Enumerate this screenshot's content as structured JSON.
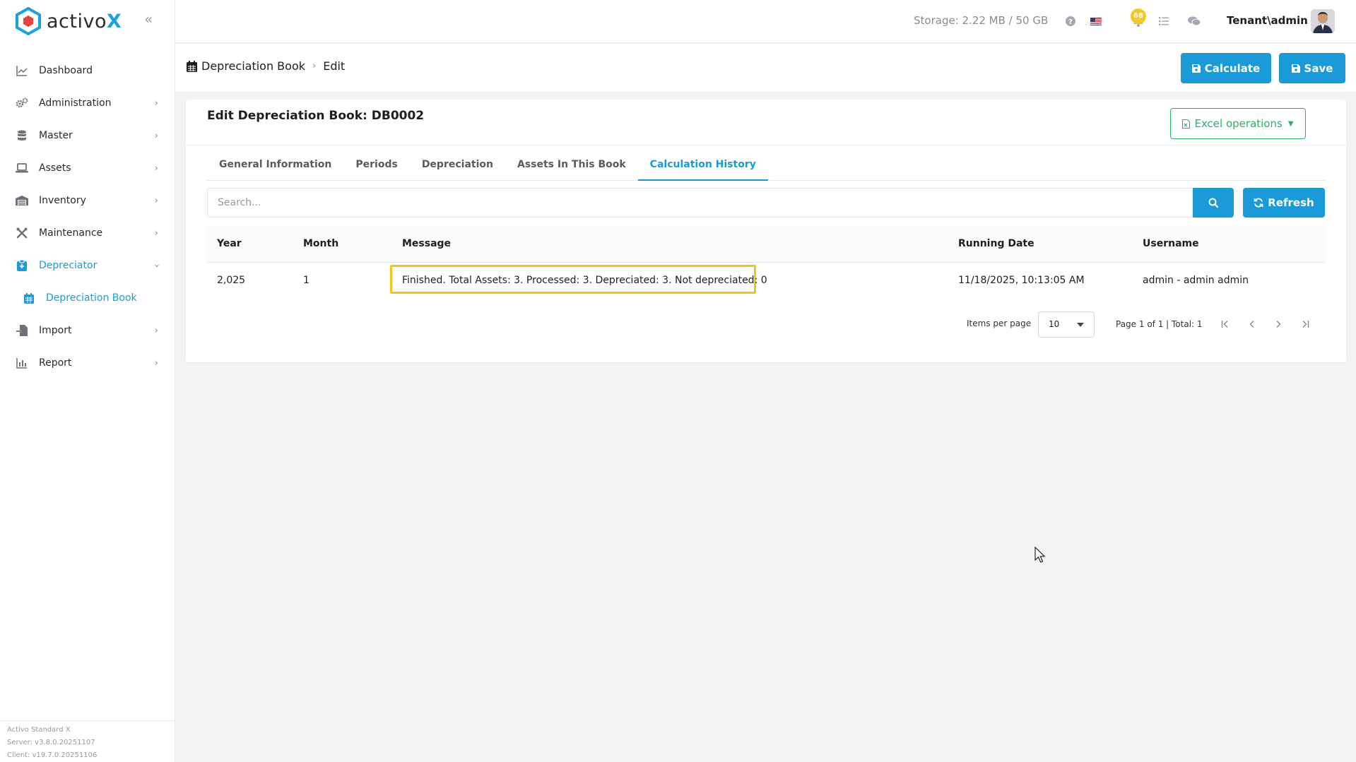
{
  "brand": {
    "name_prefix": "activo",
    "name_suffix": "X",
    "accent": "#1a9bd7",
    "logo_color": "#1aa3e0"
  },
  "sidebar": {
    "items": [
      {
        "label": "Dashboard",
        "icon": "chart-line-icon"
      },
      {
        "label": "Administration",
        "icon": "gears-icon"
      },
      {
        "label": "Master",
        "icon": "database-icon"
      },
      {
        "label": "Assets",
        "icon": "laptop-icon"
      },
      {
        "label": "Inventory",
        "icon": "warehouse-icon"
      },
      {
        "label": "Maintenance",
        "icon": "tools-icon"
      },
      {
        "label": "Depreciator",
        "icon": "clipboard-icon"
      },
      {
        "label": "Depreciation Book",
        "icon": "calendar-icon"
      },
      {
        "label": "Import",
        "icon": "file-import-icon"
      },
      {
        "label": "Report",
        "icon": "chart-bar-icon"
      }
    ],
    "footer": {
      "product": "Activo Standard X",
      "server": "Server: v3.8.0.20251107",
      "client": "Client: v19.7.0.20251106"
    }
  },
  "topbar": {
    "storage": "Storage: 2.22 MB / 50 GB",
    "notifications_count": "68",
    "user": "Tenant\\admin"
  },
  "breadcrumb": {
    "section": "Depreciation Book",
    "page": "Edit"
  },
  "actions": {
    "calculate": "Calculate",
    "save": "Save"
  },
  "card": {
    "title": "Edit Depreciation Book: DB0002",
    "excel_label": "Excel operations"
  },
  "tabs": [
    {
      "label": "General Information"
    },
    {
      "label": "Periods"
    },
    {
      "label": "Depreciation"
    },
    {
      "label": "Assets In This Book"
    },
    {
      "label": "Calculation History"
    }
  ],
  "search": {
    "placeholder": "Search...",
    "refresh_label": "Refresh"
  },
  "table": {
    "columns": [
      "Year",
      "Month",
      "Message",
      "Running Date",
      "Username"
    ],
    "rows": [
      {
        "year": "2,025",
        "month": "1",
        "message": "Finished. Total Assets: 3. Processed: 3. Depreciated: 3. Not depreciated: 0",
        "running_date": "11/18/2025, 10:13:05 AM",
        "username": "admin - admin admin"
      }
    ]
  },
  "pagination": {
    "items_per_page_label": "Items per page",
    "items_per_page": "10",
    "summary": "Page 1 of 1 | Total: 1"
  },
  "colors": {
    "highlight": "#f6c319",
    "excel_green": "#2fae6a",
    "badge": "#f7c823"
  }
}
